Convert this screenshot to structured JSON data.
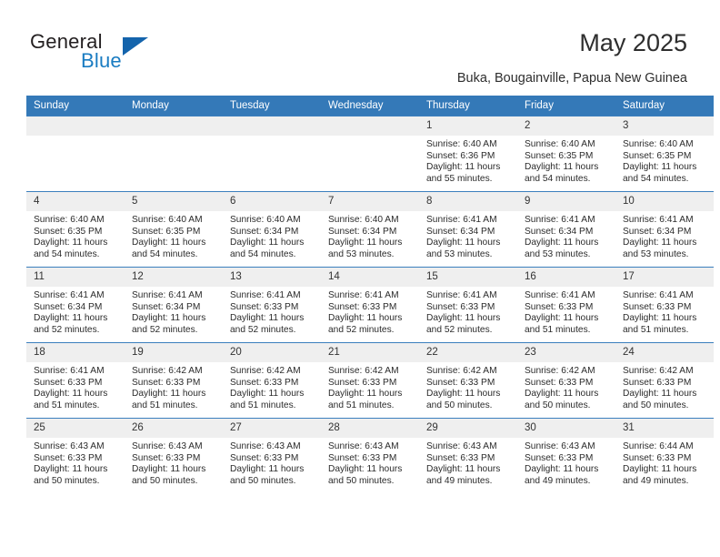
{
  "brand": {
    "name_part1": "General",
    "name_part2": "Blue",
    "logo_icon": "triangle-icon",
    "accent_color": "#1464ac",
    "blue_text_color": "#1a7cc2"
  },
  "header": {
    "title": "May 2025",
    "subtitle": "Buka, Bougainville, Papua New Guinea"
  },
  "colors": {
    "header_row_bg": "#3479b8",
    "daynum_bg": "#efefef",
    "cell_bg": "#ffffff",
    "text": "#2b2b2b"
  },
  "weekdays": [
    "Sunday",
    "Monday",
    "Tuesday",
    "Wednesday",
    "Thursday",
    "Friday",
    "Saturday"
  ],
  "weeks": [
    [
      {
        "day": "",
        "sunrise": "",
        "sunset": "",
        "daylight_line1": "",
        "daylight_line2": "",
        "empty": true
      },
      {
        "day": "",
        "sunrise": "",
        "sunset": "",
        "daylight_line1": "",
        "daylight_line2": "",
        "empty": true
      },
      {
        "day": "",
        "sunrise": "",
        "sunset": "",
        "daylight_line1": "",
        "daylight_line2": "",
        "empty": true
      },
      {
        "day": "",
        "sunrise": "",
        "sunset": "",
        "daylight_line1": "",
        "daylight_line2": "",
        "empty": true
      },
      {
        "day": "1",
        "sunrise": "Sunrise: 6:40 AM",
        "sunset": "Sunset: 6:36 PM",
        "daylight_line1": "Daylight: 11 hours",
        "daylight_line2": "and 55 minutes.",
        "empty": false
      },
      {
        "day": "2",
        "sunrise": "Sunrise: 6:40 AM",
        "sunset": "Sunset: 6:35 PM",
        "daylight_line1": "Daylight: 11 hours",
        "daylight_line2": "and 54 minutes.",
        "empty": false
      },
      {
        "day": "3",
        "sunrise": "Sunrise: 6:40 AM",
        "sunset": "Sunset: 6:35 PM",
        "daylight_line1": "Daylight: 11 hours",
        "daylight_line2": "and 54 minutes.",
        "empty": false
      }
    ],
    [
      {
        "day": "4",
        "sunrise": "Sunrise: 6:40 AM",
        "sunset": "Sunset: 6:35 PM",
        "daylight_line1": "Daylight: 11 hours",
        "daylight_line2": "and 54 minutes.",
        "empty": false
      },
      {
        "day": "5",
        "sunrise": "Sunrise: 6:40 AM",
        "sunset": "Sunset: 6:35 PM",
        "daylight_line1": "Daylight: 11 hours",
        "daylight_line2": "and 54 minutes.",
        "empty": false
      },
      {
        "day": "6",
        "sunrise": "Sunrise: 6:40 AM",
        "sunset": "Sunset: 6:34 PM",
        "daylight_line1": "Daylight: 11 hours",
        "daylight_line2": "and 54 minutes.",
        "empty": false
      },
      {
        "day": "7",
        "sunrise": "Sunrise: 6:40 AM",
        "sunset": "Sunset: 6:34 PM",
        "daylight_line1": "Daylight: 11 hours",
        "daylight_line2": "and 53 minutes.",
        "empty": false
      },
      {
        "day": "8",
        "sunrise": "Sunrise: 6:41 AM",
        "sunset": "Sunset: 6:34 PM",
        "daylight_line1": "Daylight: 11 hours",
        "daylight_line2": "and 53 minutes.",
        "empty": false
      },
      {
        "day": "9",
        "sunrise": "Sunrise: 6:41 AM",
        "sunset": "Sunset: 6:34 PM",
        "daylight_line1": "Daylight: 11 hours",
        "daylight_line2": "and 53 minutes.",
        "empty": false
      },
      {
        "day": "10",
        "sunrise": "Sunrise: 6:41 AM",
        "sunset": "Sunset: 6:34 PM",
        "daylight_line1": "Daylight: 11 hours",
        "daylight_line2": "and 53 minutes.",
        "empty": false
      }
    ],
    [
      {
        "day": "11",
        "sunrise": "Sunrise: 6:41 AM",
        "sunset": "Sunset: 6:34 PM",
        "daylight_line1": "Daylight: 11 hours",
        "daylight_line2": "and 52 minutes.",
        "empty": false
      },
      {
        "day": "12",
        "sunrise": "Sunrise: 6:41 AM",
        "sunset": "Sunset: 6:34 PM",
        "daylight_line1": "Daylight: 11 hours",
        "daylight_line2": "and 52 minutes.",
        "empty": false
      },
      {
        "day": "13",
        "sunrise": "Sunrise: 6:41 AM",
        "sunset": "Sunset: 6:33 PM",
        "daylight_line1": "Daylight: 11 hours",
        "daylight_line2": "and 52 minutes.",
        "empty": false
      },
      {
        "day": "14",
        "sunrise": "Sunrise: 6:41 AM",
        "sunset": "Sunset: 6:33 PM",
        "daylight_line1": "Daylight: 11 hours",
        "daylight_line2": "and 52 minutes.",
        "empty": false
      },
      {
        "day": "15",
        "sunrise": "Sunrise: 6:41 AM",
        "sunset": "Sunset: 6:33 PM",
        "daylight_line1": "Daylight: 11 hours",
        "daylight_line2": "and 52 minutes.",
        "empty": false
      },
      {
        "day": "16",
        "sunrise": "Sunrise: 6:41 AM",
        "sunset": "Sunset: 6:33 PM",
        "daylight_line1": "Daylight: 11 hours",
        "daylight_line2": "and 51 minutes.",
        "empty": false
      },
      {
        "day": "17",
        "sunrise": "Sunrise: 6:41 AM",
        "sunset": "Sunset: 6:33 PM",
        "daylight_line1": "Daylight: 11 hours",
        "daylight_line2": "and 51 minutes.",
        "empty": false
      }
    ],
    [
      {
        "day": "18",
        "sunrise": "Sunrise: 6:41 AM",
        "sunset": "Sunset: 6:33 PM",
        "daylight_line1": "Daylight: 11 hours",
        "daylight_line2": "and 51 minutes.",
        "empty": false
      },
      {
        "day": "19",
        "sunrise": "Sunrise: 6:42 AM",
        "sunset": "Sunset: 6:33 PM",
        "daylight_line1": "Daylight: 11 hours",
        "daylight_line2": "and 51 minutes.",
        "empty": false
      },
      {
        "day": "20",
        "sunrise": "Sunrise: 6:42 AM",
        "sunset": "Sunset: 6:33 PM",
        "daylight_line1": "Daylight: 11 hours",
        "daylight_line2": "and 51 minutes.",
        "empty": false
      },
      {
        "day": "21",
        "sunrise": "Sunrise: 6:42 AM",
        "sunset": "Sunset: 6:33 PM",
        "daylight_line1": "Daylight: 11 hours",
        "daylight_line2": "and 51 minutes.",
        "empty": false
      },
      {
        "day": "22",
        "sunrise": "Sunrise: 6:42 AM",
        "sunset": "Sunset: 6:33 PM",
        "daylight_line1": "Daylight: 11 hours",
        "daylight_line2": "and 50 minutes.",
        "empty": false
      },
      {
        "day": "23",
        "sunrise": "Sunrise: 6:42 AM",
        "sunset": "Sunset: 6:33 PM",
        "daylight_line1": "Daylight: 11 hours",
        "daylight_line2": "and 50 minutes.",
        "empty": false
      },
      {
        "day": "24",
        "sunrise": "Sunrise: 6:42 AM",
        "sunset": "Sunset: 6:33 PM",
        "daylight_line1": "Daylight: 11 hours",
        "daylight_line2": "and 50 minutes.",
        "empty": false
      }
    ],
    [
      {
        "day": "25",
        "sunrise": "Sunrise: 6:43 AM",
        "sunset": "Sunset: 6:33 PM",
        "daylight_line1": "Daylight: 11 hours",
        "daylight_line2": "and 50 minutes.",
        "empty": false
      },
      {
        "day": "26",
        "sunrise": "Sunrise: 6:43 AM",
        "sunset": "Sunset: 6:33 PM",
        "daylight_line1": "Daylight: 11 hours",
        "daylight_line2": "and 50 minutes.",
        "empty": false
      },
      {
        "day": "27",
        "sunrise": "Sunrise: 6:43 AM",
        "sunset": "Sunset: 6:33 PM",
        "daylight_line1": "Daylight: 11 hours",
        "daylight_line2": "and 50 minutes.",
        "empty": false
      },
      {
        "day": "28",
        "sunrise": "Sunrise: 6:43 AM",
        "sunset": "Sunset: 6:33 PM",
        "daylight_line1": "Daylight: 11 hours",
        "daylight_line2": "and 50 minutes.",
        "empty": false
      },
      {
        "day": "29",
        "sunrise": "Sunrise: 6:43 AM",
        "sunset": "Sunset: 6:33 PM",
        "daylight_line1": "Daylight: 11 hours",
        "daylight_line2": "and 49 minutes.",
        "empty": false
      },
      {
        "day": "30",
        "sunrise": "Sunrise: 6:43 AM",
        "sunset": "Sunset: 6:33 PM",
        "daylight_line1": "Daylight: 11 hours",
        "daylight_line2": "and 49 minutes.",
        "empty": false
      },
      {
        "day": "31",
        "sunrise": "Sunrise: 6:44 AM",
        "sunset": "Sunset: 6:33 PM",
        "daylight_line1": "Daylight: 11 hours",
        "daylight_line2": "and 49 minutes.",
        "empty": false
      }
    ]
  ]
}
